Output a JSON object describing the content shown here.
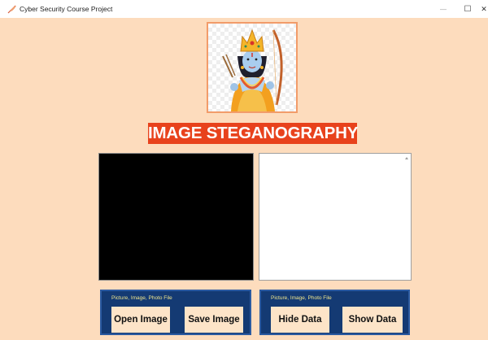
{
  "window": {
    "title": "Cyber Security Course Project",
    "controls": {
      "minimize": "—",
      "maximize": "☐",
      "close": "✕"
    },
    "app_icon": "feather-icon"
  },
  "logo": {
    "icon": "deity-logo-image"
  },
  "banner": {
    "title": "IMAGE STEGANOGRAPHY"
  },
  "panels": {
    "image_preview_background": "#000000",
    "text_area_value": ""
  },
  "left_box": {
    "caption": "Picture, Image, Photo File",
    "open_label": "Open Image",
    "save_label": "Save Image"
  },
  "right_box": {
    "caption": "Picture, Image, Photo File",
    "hide_label": "Hide Data",
    "show_label": "Show Data"
  },
  "colors": {
    "window_bg": "#fddcbd",
    "banner_bg": "#e8421c",
    "box_bg": "#143a73",
    "button_bg": "#fde4c8",
    "caption": "#f0e68c"
  }
}
